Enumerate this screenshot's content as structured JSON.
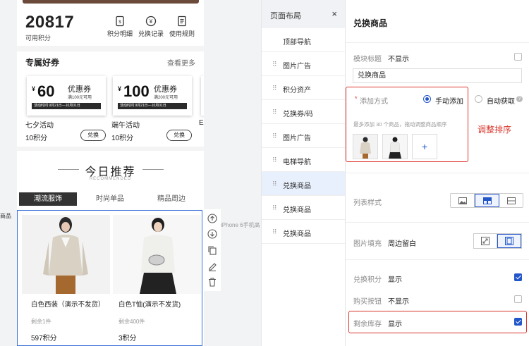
{
  "preview": {
    "points_value": "20817",
    "points_label": "可用积分",
    "quick_actions": [
      {
        "label": "积分明细",
        "icon": "ledger-icon"
      },
      {
        "label": "兑换记录",
        "icon": "yen-circle-icon"
      },
      {
        "label": "使用规则",
        "icon": "document-icon"
      }
    ],
    "coupons_section": {
      "title": "专属好券",
      "more": "查看更多"
    },
    "coupons": [
      {
        "currency": "¥",
        "value": "60",
        "name": "优惠券",
        "condition": "满100元可用",
        "period": "活动时间  9月21日—10月01日",
        "activity": "七夕活动",
        "points": "10积分",
        "button": "兑换"
      },
      {
        "currency": "¥",
        "value": "100",
        "name": "优惠券",
        "condition": "满200元可用",
        "period": "活动时间  9月21日—10月01日",
        "activity": "端午活动",
        "points": "10积分",
        "button": "兑换"
      }
    ],
    "clipped_activity": "E",
    "today": {
      "title": "今日推荐",
      "subtitle": "RECOMMENDED"
    },
    "tabs": [
      "潮流服饰",
      "时尚单品",
      "精品周边"
    ],
    "active_tab": 0,
    "products": [
      {
        "name": "白色西装（演示不发货）",
        "stock": "剩余1件",
        "points": "597积分"
      },
      {
        "name": "白色T恤(演示不发货)",
        "stock": "剩余400件",
        "points": "3积分"
      }
    ],
    "left_clip_text": "商品",
    "phone_model": "iPhone 6手机高"
  },
  "tools": [
    {
      "name": "move-up-icon"
    },
    {
      "name": "move-down-icon"
    },
    {
      "name": "copy-icon"
    },
    {
      "name": "edit-icon"
    },
    {
      "name": "delete-icon"
    }
  ],
  "layout_panel": {
    "title": "页面布局",
    "close": "×",
    "items": [
      {
        "label": "顶部导航",
        "grip": false
      },
      {
        "label": "图片广告",
        "grip": true
      },
      {
        "label": "积分资产",
        "grip": true
      },
      {
        "label": "兑换券/码",
        "grip": true
      },
      {
        "label": "图片广告",
        "grip": true
      },
      {
        "label": "电梯导航",
        "grip": true
      },
      {
        "label": "兑换商品",
        "grip": true,
        "active": true
      },
      {
        "label": "兑换商品",
        "grip": true
      },
      {
        "label": "兑换商品",
        "grip": true
      }
    ]
  },
  "settings": {
    "title": "兑换商品",
    "module_title": {
      "label": "模块标题",
      "value": "不显示",
      "checked": false
    },
    "module_title_input": "兑换商品",
    "add_method": {
      "label": "添加方式",
      "required_mark": "*",
      "options": [
        "手动添加",
        "自动获取"
      ],
      "selected": 0
    },
    "add_hint": "最多添加 30 个商品，拖动调整商品顺序",
    "add_button": "+",
    "annotation": "调整排序",
    "list_style": {
      "label": "列表样式",
      "options": [
        "image-icon",
        "grid-icon",
        "list-icon"
      ],
      "selected": 1
    },
    "image_fill": {
      "label": "图片填充",
      "value": "周边留白",
      "options": [
        "fill-icon",
        "padding-icon"
      ],
      "selected": 1
    },
    "exchange_points": {
      "label": "兑换积分",
      "value": "显示",
      "checked": true
    },
    "buy_button": {
      "label": "购买按钮",
      "value": "不显示",
      "checked": false
    },
    "stock_remaining": {
      "label": "剩余库存",
      "value": "显示",
      "checked": true
    },
    "colors": {
      "accent": "#2256c9",
      "annotation": "#d9352b"
    }
  }
}
